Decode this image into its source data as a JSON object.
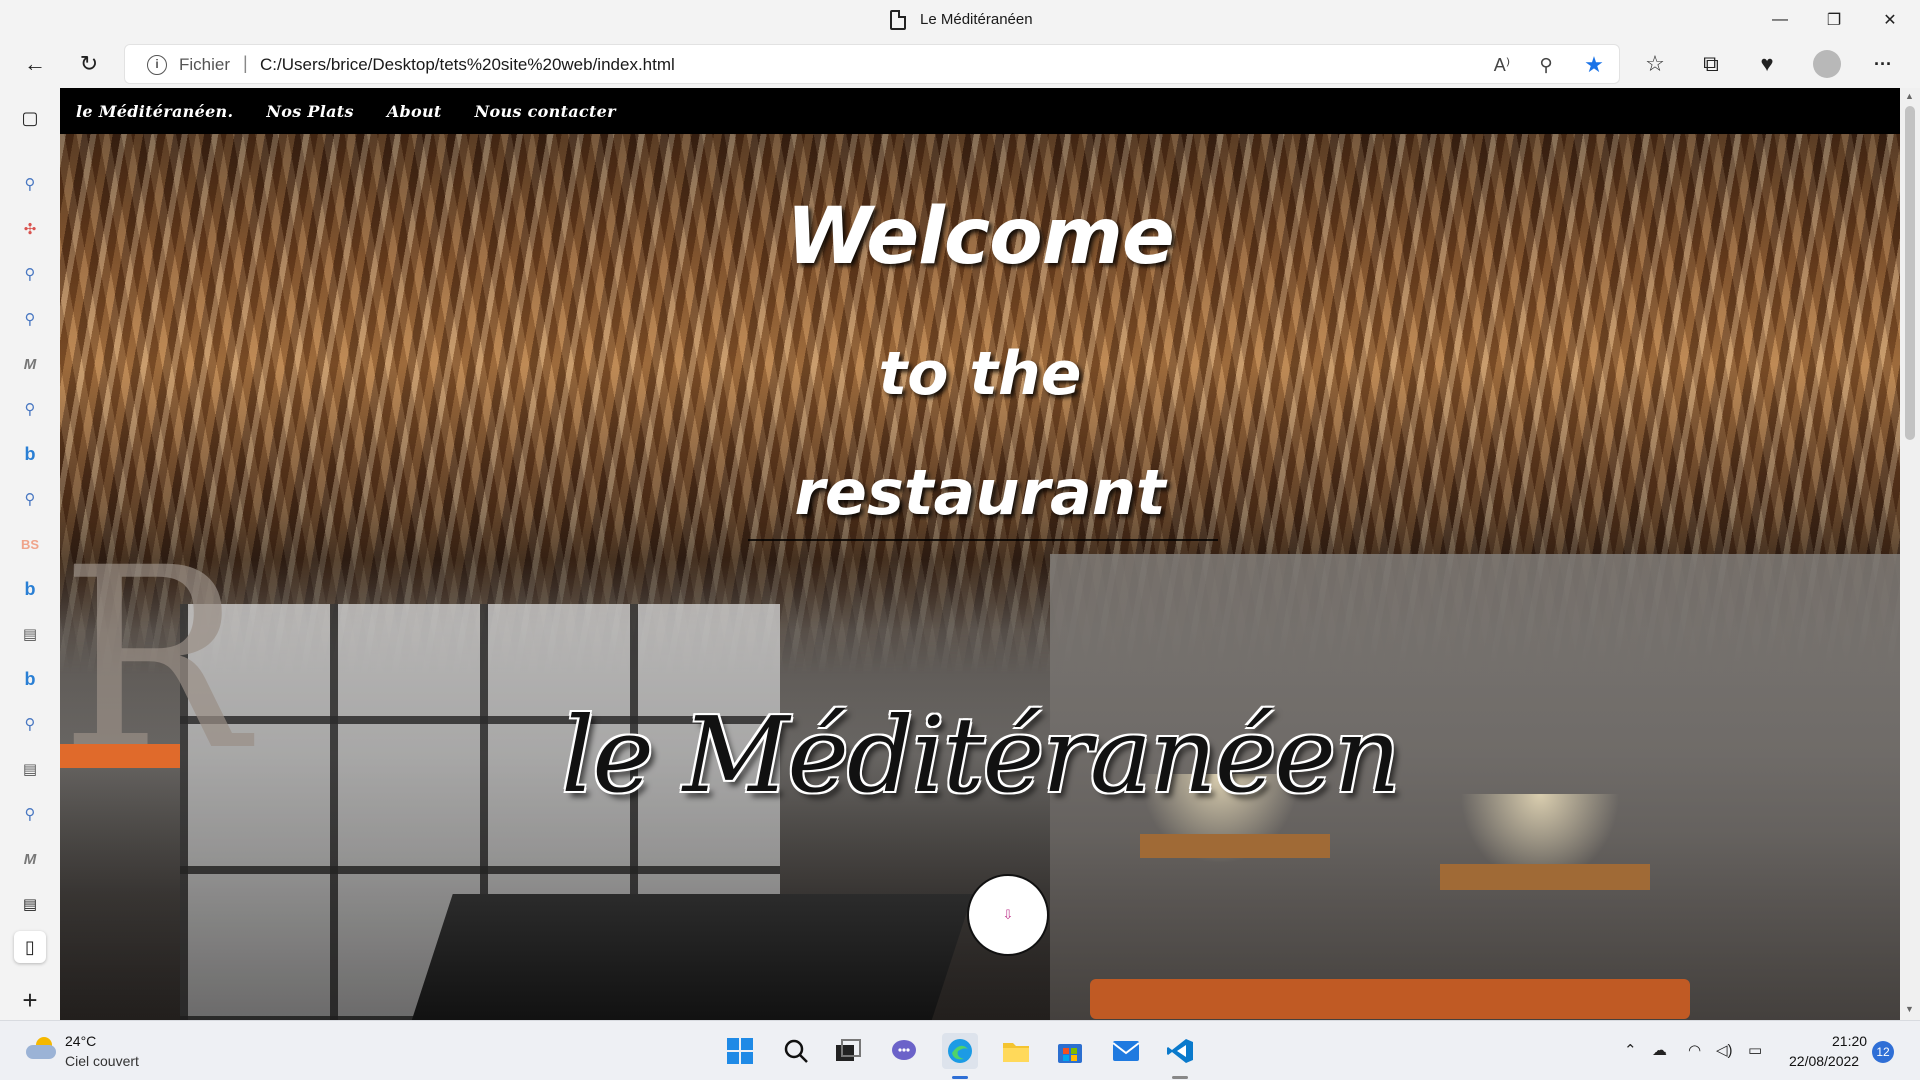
{
  "window": {
    "title": "Le Méditéranéen",
    "minimize_icon": "—",
    "maximize_icon": "❐",
    "close_icon": "✕"
  },
  "toolbar": {
    "back_icon": "←",
    "refresh_icon": "↻",
    "scheme_label": "Fichier",
    "separator": "|",
    "url": "C:/Users/brice/Desktop/tets%20site%20web/index.html",
    "read_aloud_icon": "A⁾",
    "zoom_icon": "⚲",
    "favorite_icon": "★",
    "favorites_icon": "☆",
    "collections_icon": "⧉",
    "health_icon": "♥",
    "more_icon": "···",
    "accent_color": "#1a73e8"
  },
  "sidebar": {
    "items": [
      {
        "icon": "tab-actions-icon",
        "glyph": "▢"
      },
      {
        "icon": "search-icon",
        "glyph": "⚲"
      },
      {
        "icon": "apps-icon",
        "glyph": "✣"
      },
      {
        "icon": "search-icon",
        "glyph": "⚲"
      },
      {
        "icon": "search-icon",
        "glyph": "⚲"
      },
      {
        "icon": "m-icon",
        "glyph": "M"
      },
      {
        "icon": "search-icon",
        "glyph": "⚲"
      },
      {
        "icon": "bing-icon",
        "glyph": "b"
      },
      {
        "icon": "search-icon",
        "glyph": "⚲"
      },
      {
        "icon": "bs-icon",
        "glyph": "BS"
      },
      {
        "icon": "bing-icon",
        "glyph": "b"
      },
      {
        "icon": "calendar-icon",
        "glyph": "▤"
      },
      {
        "icon": "bing-icon",
        "glyph": "b"
      },
      {
        "icon": "search-icon",
        "glyph": "⚲"
      },
      {
        "icon": "calendar-icon",
        "glyph": "▤"
      },
      {
        "icon": "search-icon",
        "glyph": "⚲"
      },
      {
        "icon": "m-icon",
        "glyph": "M"
      },
      {
        "icon": "calendar-icon",
        "glyph": "▤"
      },
      {
        "icon": "page-icon",
        "glyph": "▯"
      }
    ],
    "add_icon": "+"
  },
  "site": {
    "nav": [
      "le Méditéranéen.",
      "Nos Plats",
      "About",
      "Nous contacter"
    ],
    "hero_line1": "Welcome",
    "hero_line2": "to the",
    "hero_line3": "restaurant",
    "brand": "le Méditéranéen",
    "scroll_button": "⇩",
    "text_color": "#ffffff",
    "nav_bg": "#000000"
  },
  "taskbar": {
    "weather_temp": "24°C",
    "weather_condition": "Ciel couvert",
    "apps": [
      "windows-start-icon",
      "search-icon",
      "task-view-icon",
      "teams-chat-icon",
      "edge-icon",
      "file-explorer-icon",
      "store-icon",
      "mail-icon",
      "vscode-icon"
    ],
    "time": "21:20",
    "date": "22/08/2022",
    "notifications": "12",
    "tray_chevron": "⌃"
  }
}
